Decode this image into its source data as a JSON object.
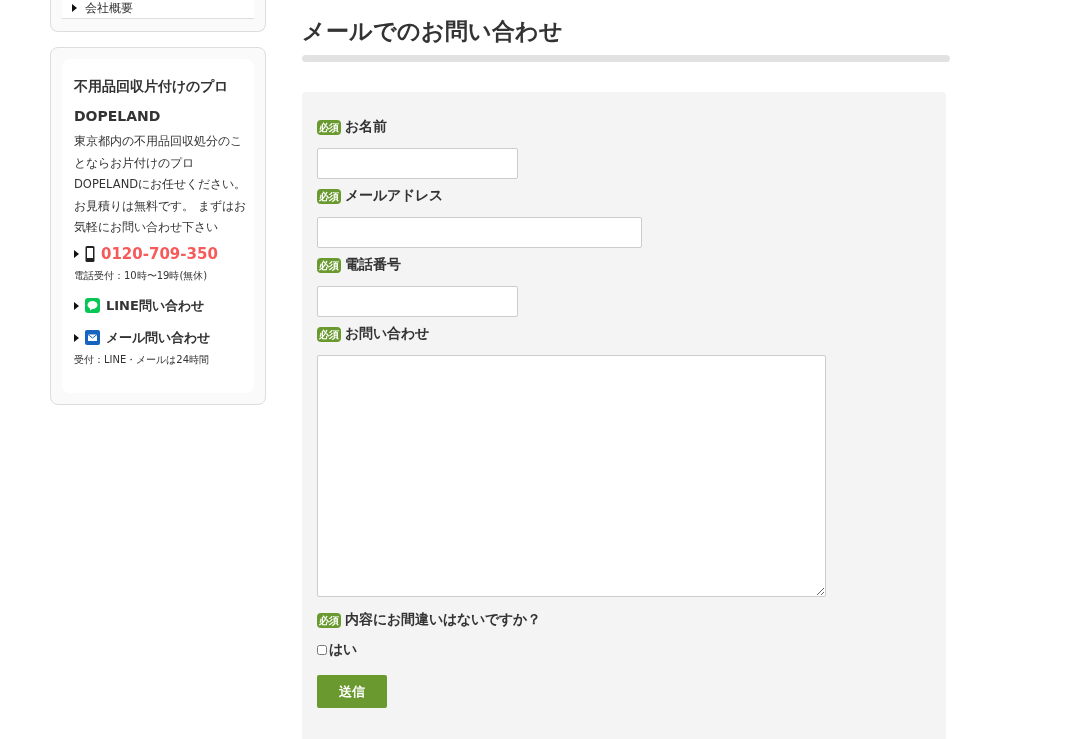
{
  "sidebar": {
    "menu_items": [
      "会社概要"
    ],
    "promo": {
      "title": "不用品回収片付けのプロDOPELAND",
      "description": "東京都内の不用品回収処分のことならお片付けのプロDOPELANDにお任せください。お見積りは無料です。 まずはお気軽にお問い合わせ下さい",
      "contacts": [
        {
          "kind": "phone",
          "label": "0120-709-350",
          "note": "電話受付：10時〜19時(無休)"
        },
        {
          "kind": "line",
          "label": "LINE問い合わせ"
        },
        {
          "kind": "mail",
          "label": "メール問い合わせ",
          "note": "受付：LINE・メールは24時間"
        }
      ]
    }
  },
  "page_title": "メールでのお問い合わせ",
  "form": {
    "fields": [
      {
        "kind": "text",
        "label": "お名前",
        "required_badge": "必須"
      },
      {
        "kind": "email",
        "label": "メールアドレス",
        "required_badge": "必須"
      },
      {
        "kind": "tel",
        "label": "電話番号",
        "required_badge": "必須"
      },
      {
        "kind": "textarea",
        "label": "お問い合わせ",
        "required_badge": "必須"
      },
      {
        "kind": "checkbox",
        "label": "内容にお間違いはないですか？",
        "required_badge": "必須",
        "option": "はい",
        "checked": false
      }
    ],
    "submit": "送信"
  }
}
